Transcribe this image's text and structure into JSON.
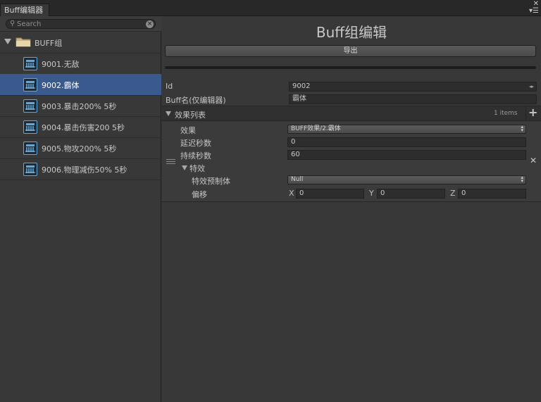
{
  "window": {
    "tab_label": "Buff编辑器"
  },
  "search": {
    "placeholder": "Search"
  },
  "tree": {
    "group_label": "BUFF组",
    "items": [
      {
        "label": "9001.无敌",
        "selected": false
      },
      {
        "label": "9002.霸体",
        "selected": true
      },
      {
        "label": "9003.暴击200% 5秒",
        "selected": false
      },
      {
        "label": "9004.暴击伤害200 5秒",
        "selected": false
      },
      {
        "label": "9005.物攻200% 5秒",
        "selected": false
      },
      {
        "label": "9006.物理减伤50% 5秒",
        "selected": false
      }
    ]
  },
  "editor": {
    "title": "Buff组编辑",
    "export_label": "导出",
    "id_label": "Id",
    "id_value": "9002",
    "name_label": "Buff名(仅编辑器)",
    "name_value": "霸体",
    "effects": {
      "header_label": "效果列表",
      "count_label": "1 items",
      "effect_label": "效果",
      "effect_value": "BUFF效果/2.霸体",
      "delay_label": "延迟秒数",
      "delay_value": "0",
      "duration_label": "持续秒数",
      "duration_value": "60",
      "fx_label": "特效",
      "fx_prefab_label": "特效预制体",
      "fx_prefab_value": "Null",
      "offset_label": "偏移",
      "offset": {
        "x_label": "X",
        "x": "0",
        "y_label": "Y",
        "y": "0",
        "z_label": "Z",
        "z": "0"
      }
    }
  },
  "colors": {
    "selection": "#3a5a8e",
    "icon_border": "#5fa9dc",
    "background": "#383838"
  }
}
